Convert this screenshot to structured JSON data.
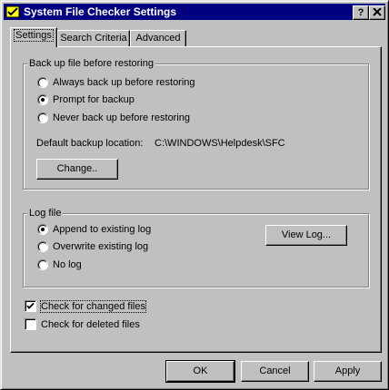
{
  "window": {
    "title": "System File Checker Settings",
    "help_button": "?",
    "close_button": "✕"
  },
  "tabs": [
    {
      "label": "Settings",
      "active": true
    },
    {
      "label": "Search Criteria",
      "active": false
    },
    {
      "label": "Advanced",
      "active": false
    }
  ],
  "backup_group": {
    "legend": "Back up file before restoring",
    "options": [
      {
        "label": "Always back up before restoring",
        "selected": false
      },
      {
        "label": "Prompt for backup",
        "selected": true
      },
      {
        "label": "Never back up before restoring",
        "selected": false
      }
    ],
    "location_label": "Default backup location:",
    "location_value": "C:\\WINDOWS\\Helpdesk\\SFC",
    "change_button": "Change.."
  },
  "log_group": {
    "legend": "Log file",
    "options": [
      {
        "label": "Append to existing log",
        "selected": true
      },
      {
        "label": "Overwrite existing log",
        "selected": false
      },
      {
        "label": "No log",
        "selected": false
      }
    ],
    "view_log_button": "View Log..."
  },
  "checkboxes": [
    {
      "label": "Check for changed files",
      "checked": true
    },
    {
      "label": "Check for deleted files",
      "checked": false
    }
  ],
  "footer": {
    "ok": "OK",
    "cancel": "Cancel",
    "apply": "Apply"
  }
}
